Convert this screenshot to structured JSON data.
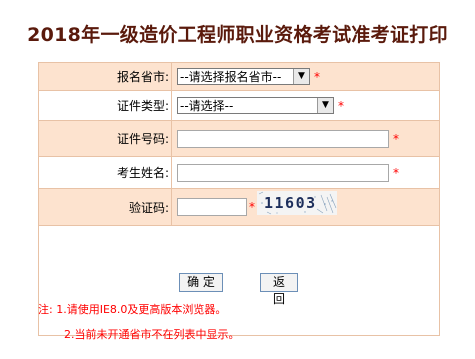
{
  "title": "2018年一级造价工程师职业资格考试准考证打印",
  "form": {
    "province": {
      "label": "报名省市:",
      "value": "--请选择报名省市--",
      "required": "*"
    },
    "id_type": {
      "label": "证件类型:",
      "value": "--请选择--",
      "required": "*"
    },
    "id_number": {
      "label": "证件号码:",
      "value": "",
      "required": "*"
    },
    "name": {
      "label": "考生姓名:",
      "value": "",
      "required": "*"
    },
    "captcha": {
      "label": "验证码:",
      "value": "",
      "required": "*",
      "image_text": "11603"
    }
  },
  "buttons": {
    "confirm": "确 定",
    "back": "返 回"
  },
  "notes": {
    "line1": "注: 1.请使用IE8.0及更高版本浏览器。",
    "line2": "2.当前未开通省市不在列表中显示。"
  },
  "colors": {
    "title": "#5a1a0c",
    "row_peach": "#fde3cf",
    "required": "#ff0000"
  }
}
